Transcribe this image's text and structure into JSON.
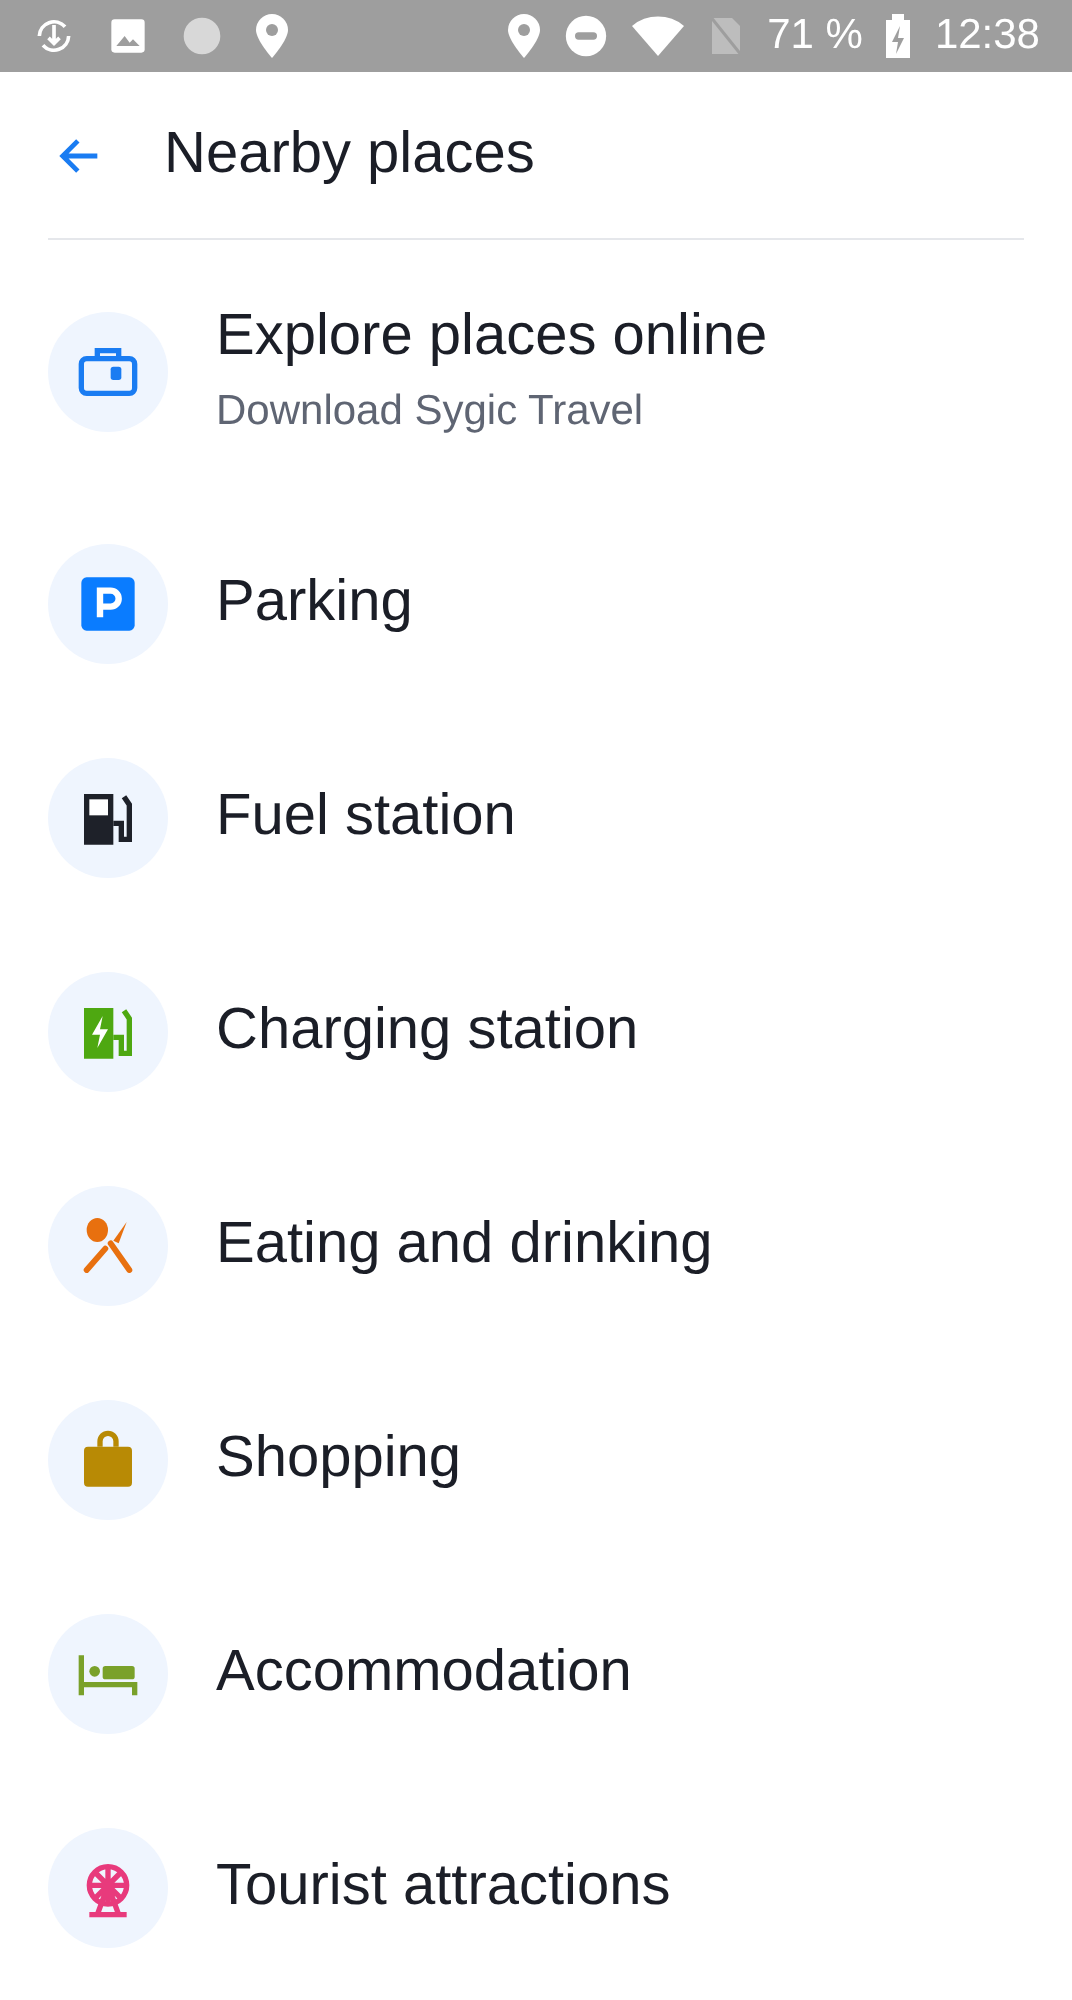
{
  "status_bar": {
    "battery": "71 %",
    "time": "12:38"
  },
  "header": {
    "title": "Nearby places"
  },
  "items": [
    {
      "kind": "suitcase",
      "color": "#1a7cf2",
      "label": "Explore places online",
      "subtitle": "Download Sygic Travel"
    },
    {
      "kind": "parking",
      "color": "#0a7cff",
      "label": "Parking"
    },
    {
      "kind": "fuel",
      "color": "#1e2129",
      "label": "Fuel station"
    },
    {
      "kind": "charging",
      "color": "#4ea811",
      "label": "Charging station"
    },
    {
      "kind": "food",
      "color": "#e8700f",
      "label": "Eating and drinking"
    },
    {
      "kind": "shopping",
      "color": "#b88a05",
      "label": "Shopping"
    },
    {
      "kind": "bed",
      "color": "#7aa12a",
      "label": "Accommodation"
    },
    {
      "kind": "ferris",
      "color": "#e83a7c",
      "label": "Tourist attractions"
    }
  ]
}
